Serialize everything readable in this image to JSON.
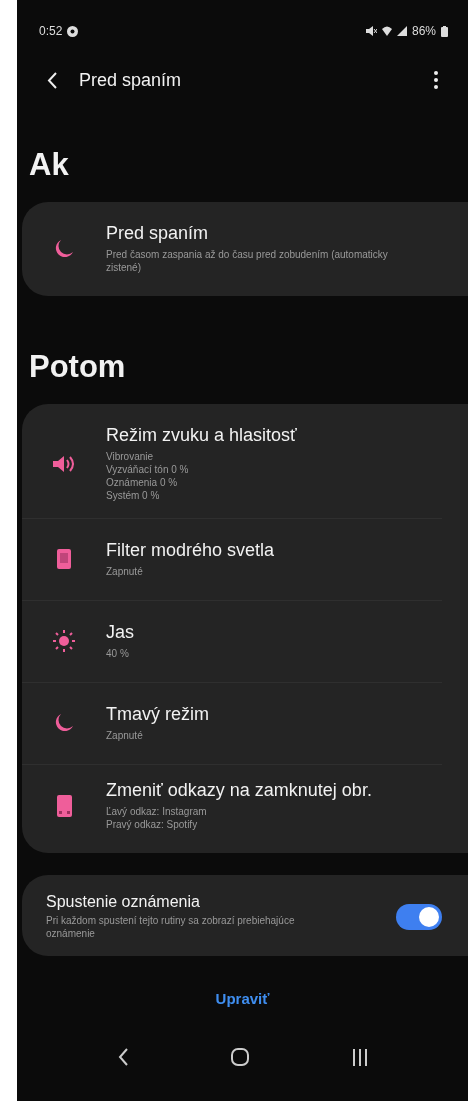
{
  "status_bar": {
    "time": "0:52",
    "battery": "86%"
  },
  "app_bar": {
    "title": "Pred spaním"
  },
  "sections": [
    {
      "heading": "Ak",
      "items": [
        {
          "kind": "moon",
          "title": "Pred spaním",
          "details": [
            "Pred časom zaspania až do času pred zobudením (automaticky zistené)"
          ]
        }
      ]
    },
    {
      "heading": "Potom",
      "items": [
        {
          "kind": "speaker",
          "title": "Režim zvuku a hlasitosť",
          "details": [
            "Vibrovanie",
            "Vyzváňací tón 0 %",
            "Oznámenia 0 %",
            "Systém 0 %"
          ]
        },
        {
          "kind": "filter",
          "title": "Filter modrého svetla",
          "details": [
            "Zapnuté"
          ]
        },
        {
          "kind": "sun",
          "title": "Jas",
          "details": [
            "40 %"
          ]
        },
        {
          "kind": "moon",
          "title": "Tmavý režim",
          "details": [
            "Zapnuté"
          ]
        },
        {
          "kind": "lockscreen",
          "title": "Zmeniť odkazy na zamknutej obr.",
          "details": [
            "Ľavý odkaz: Instagram",
            "Pravý odkaz: Spotify"
          ]
        }
      ]
    }
  ],
  "notification_toggle": {
    "title": "Spustenie oznámenia",
    "description": "Pri každom spustení tejto rutiny sa zobrazí prebiehajúce oznámenie",
    "on": true
  },
  "edit_button": "Upraviť"
}
